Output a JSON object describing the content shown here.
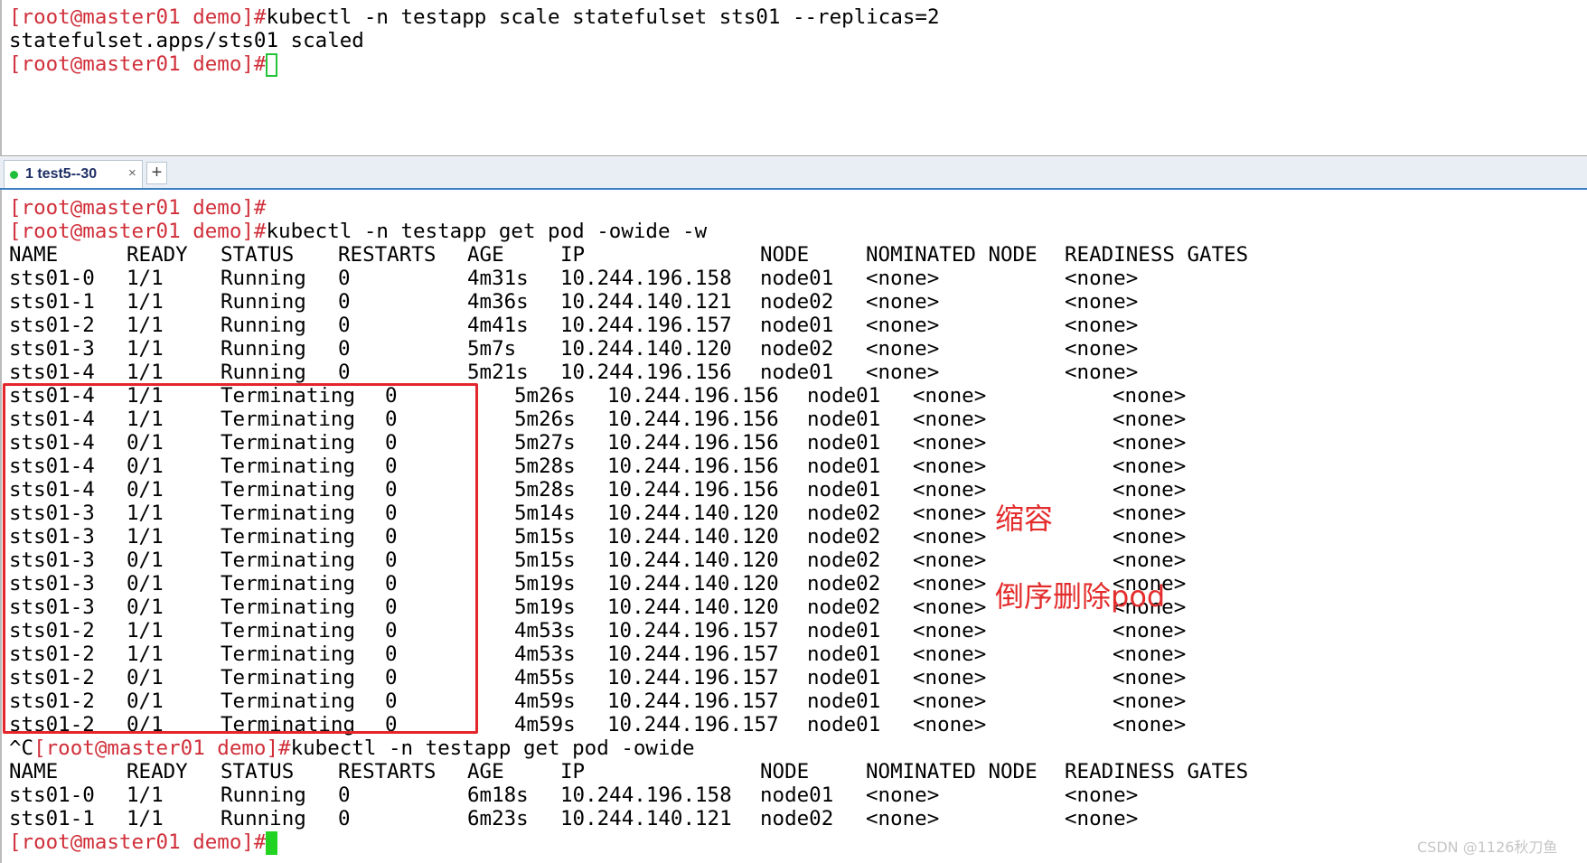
{
  "top_pane": {
    "lines": [
      {
        "prompt": "[root@master01 demo]#",
        "cmd": "kubectl -n testapp scale statefulset sts01 --replicas=2"
      },
      {
        "prompt": "",
        "cmd": "statefulset.apps/sts01 scaled"
      },
      {
        "prompt": "[root@master01 demo]#",
        "cmd": ""
      }
    ]
  },
  "tab_bar": {
    "tab_label": "1 test5--30",
    "tab_close": "×",
    "add_tab": "+"
  },
  "bottom_pane": {
    "pre_lines": [
      {
        "prefix": "",
        "prompt": "[root@master01 demo]#",
        "cmd": ""
      },
      {
        "prefix": "",
        "prompt": "[root@master01 demo]#",
        "cmd": "kubectl -n testapp get pod -owide -w"
      }
    ],
    "headers": [
      "NAME",
      "READY",
      "STATUS",
      "RESTARTS",
      "AGE",
      "IP",
      "NODE",
      "NOMINATED NODE",
      "READINESS GATES"
    ],
    "watch_rows": [
      [
        "sts01-0",
        "1/1",
        "Running",
        "0",
        "4m31s",
        "10.244.196.158",
        "node01",
        "<none>",
        "<none>"
      ],
      [
        "sts01-1",
        "1/1",
        "Running",
        "0",
        "4m36s",
        "10.244.140.121",
        "node02",
        "<none>",
        "<none>"
      ],
      [
        "sts01-2",
        "1/1",
        "Running",
        "0",
        "4m41s",
        "10.244.196.157",
        "node01",
        "<none>",
        "<none>"
      ],
      [
        "sts01-3",
        "1/1",
        "Running",
        "0",
        "5m7s",
        "10.244.140.120",
        "node02",
        "<none>",
        "<none>"
      ],
      [
        "sts01-4",
        "1/1",
        "Running",
        "0",
        "5m21s",
        "10.244.196.156",
        "node01",
        "<none>",
        "<none>"
      ]
    ],
    "term_rows": [
      [
        "sts01-4",
        "1/1",
        "Terminating",
        "0",
        "5m26s",
        "10.244.196.156",
        "node01",
        "<none>",
        "<none>"
      ],
      [
        "sts01-4",
        "1/1",
        "Terminating",
        "0",
        "5m26s",
        "10.244.196.156",
        "node01",
        "<none>",
        "<none>"
      ],
      [
        "sts01-4",
        "0/1",
        "Terminating",
        "0",
        "5m27s",
        "10.244.196.156",
        "node01",
        "<none>",
        "<none>"
      ],
      [
        "sts01-4",
        "0/1",
        "Terminating",
        "0",
        "5m28s",
        "10.244.196.156",
        "node01",
        "<none>",
        "<none>"
      ],
      [
        "sts01-4",
        "0/1",
        "Terminating",
        "0",
        "5m28s",
        "10.244.196.156",
        "node01",
        "<none>",
        "<none>"
      ],
      [
        "sts01-3",
        "1/1",
        "Terminating",
        "0",
        "5m14s",
        "10.244.140.120",
        "node02",
        "<none>",
        "<none>"
      ],
      [
        "sts01-3",
        "1/1",
        "Terminating",
        "0",
        "5m15s",
        "10.244.140.120",
        "node02",
        "<none>",
        "<none>"
      ],
      [
        "sts01-3",
        "0/1",
        "Terminating",
        "0",
        "5m15s",
        "10.244.140.120",
        "node02",
        "<none>",
        "<none>"
      ],
      [
        "sts01-3",
        "0/1",
        "Terminating",
        "0",
        "5m19s",
        "10.244.140.120",
        "node02",
        "<none>",
        "<none>"
      ],
      [
        "sts01-3",
        "0/1",
        "Terminating",
        "0",
        "5m19s",
        "10.244.140.120",
        "node02",
        "<none>",
        "<none>"
      ],
      [
        "sts01-2",
        "1/1",
        "Terminating",
        "0",
        "4m53s",
        "10.244.196.157",
        "node01",
        "<none>",
        "<none>"
      ],
      [
        "sts01-2",
        "1/1",
        "Terminating",
        "0",
        "4m53s",
        "10.244.196.157",
        "node01",
        "<none>",
        "<none>"
      ],
      [
        "sts01-2",
        "0/1",
        "Terminating",
        "0",
        "4m55s",
        "10.244.196.157",
        "node01",
        "<none>",
        "<none>"
      ],
      [
        "sts01-2",
        "0/1",
        "Terminating",
        "0",
        "4m59s",
        "10.244.196.157",
        "node01",
        "<none>",
        "<none>"
      ],
      [
        "sts01-2",
        "0/1",
        "Terminating",
        "0",
        "4m59s",
        "10.244.196.157",
        "node01",
        "<none>",
        "<none>"
      ]
    ],
    "second_cmd": {
      "prefix": "^C",
      "prompt": "[root@master01 demo]#",
      "cmd": "kubectl -n testapp get pod -owide"
    },
    "final_rows": [
      [
        "sts01-0",
        "1/1",
        "Running",
        "0",
        "6m18s",
        "10.244.196.158",
        "node01",
        "<none>",
        "<none>"
      ],
      [
        "sts01-1",
        "1/1",
        "Running",
        "0",
        "6m23s",
        "10.244.140.121",
        "node02",
        "<none>",
        "<none>"
      ]
    ],
    "final_prompt": "[root@master01 demo]#"
  },
  "annotations": {
    "scale_down": "缩容",
    "reverse_delete": "倒序删除pod"
  },
  "watermark": "CSDN @1126秋刀鱼",
  "colors": {
    "prompt": "#d02f3a",
    "cursor": "#22d321",
    "highlight": "#e3262b"
  }
}
